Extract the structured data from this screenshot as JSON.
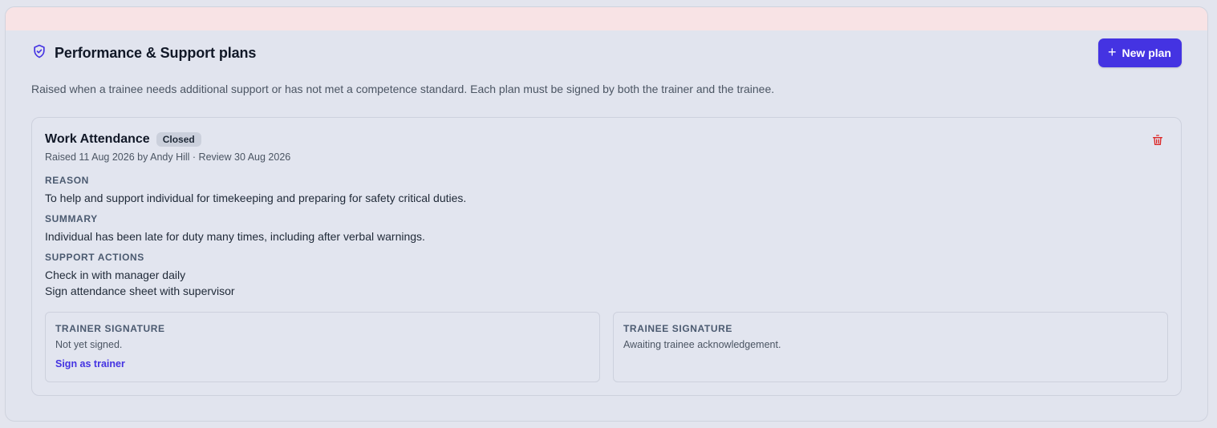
{
  "colors": {
    "accent": "#4433e2",
    "danger": "#dc2626",
    "alert_band": "#f8e3e5"
  },
  "header": {
    "icon": "shield-check-icon",
    "title": "Performance & Support plans",
    "new_plan_label": "New plan",
    "new_plan_icon": "plus-icon"
  },
  "description": "Raised when a trainee needs additional support or has not met a competence standard. Each plan must be signed by both the trainer and the trainee.",
  "plan": {
    "title": "Work Attendance",
    "status": "Closed",
    "meta": "Raised 11 Aug 2026 by Andy Hill · Review 30 Aug 2026",
    "delete_icon": "trash-icon",
    "reason_label": "REASON",
    "reason": "To help and support individual for timekeeping and preparing for safety critical duties.",
    "summary_label": "SUMMARY",
    "summary": "Individual has been late for duty many times, including after verbal warnings.",
    "actions_label": "SUPPORT ACTIONS",
    "actions": [
      "Check in with manager daily",
      "Sign attendance sheet with supervisor"
    ],
    "trainer_signature": {
      "label": "TRAINER SIGNATURE",
      "status": "Not yet signed.",
      "action": "Sign as trainer"
    },
    "trainee_signature": {
      "label": "TRAINEE SIGNATURE",
      "status": "Awaiting trainee acknowledgement."
    }
  }
}
